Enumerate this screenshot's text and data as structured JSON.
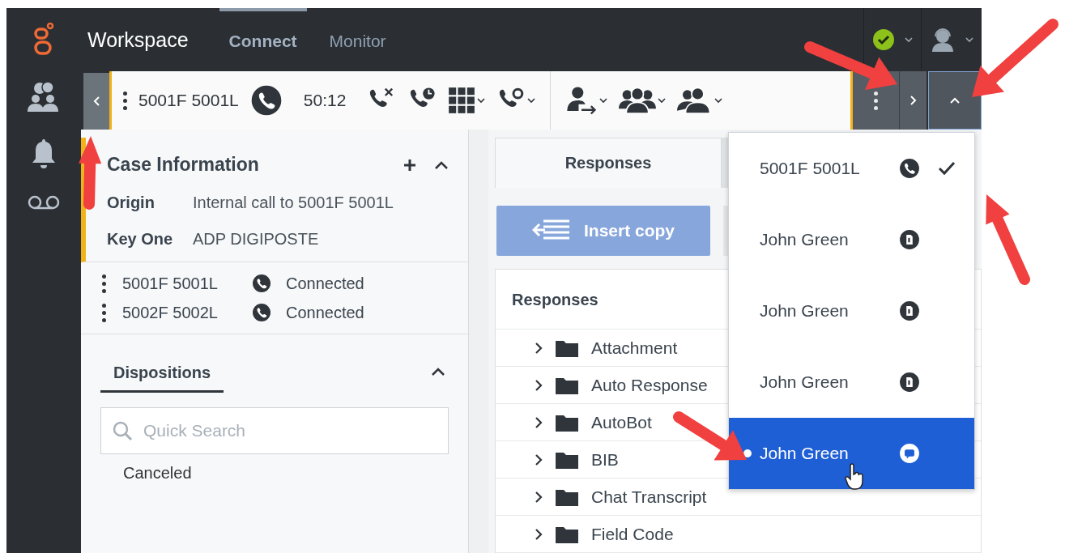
{
  "header": {
    "app_name": "Workspace",
    "nav": [
      {
        "label": "Connect",
        "selected": true
      },
      {
        "label": "Monitor",
        "selected": false
      }
    ]
  },
  "rail": {
    "items": [
      {
        "kind": "contacts"
      },
      {
        "kind": "bell"
      },
      {
        "kind": "voicemail"
      }
    ]
  },
  "toolbar": {
    "party": "5001F 5001L",
    "timer": "50:12",
    "actions": [
      {
        "kind": "end-call",
        "dropdown": false
      },
      {
        "kind": "hold-call",
        "dropdown": false
      },
      {
        "kind": "keypad",
        "dropdown": true
      },
      {
        "kind": "call-voicemail",
        "dropdown": true
      },
      {
        "kind": "transfer",
        "dropdown": true
      },
      {
        "kind": "conference",
        "dropdown": true
      },
      {
        "kind": "consult",
        "dropdown": true
      }
    ]
  },
  "case_info": {
    "title": "Case Information",
    "fields": [
      {
        "label": "Origin",
        "value": "Internal call to 5001F 5001L"
      },
      {
        "label": "Key One",
        "value": "ADP DIGIPOSTE"
      }
    ]
  },
  "parties": [
    {
      "name": "5001F 5001L",
      "status": "Connected"
    },
    {
      "name": "5002F 5002L",
      "status": "Connected"
    }
  ],
  "dispositions": {
    "tab": "Dispositions",
    "placeholder": "Quick Search",
    "items": [
      "Canceled"
    ]
  },
  "responses": {
    "tabs": [
      {
        "label": "Responses",
        "selected": true
      }
    ],
    "insert_button": {
      "label": "Insert copy",
      "disabled": true
    },
    "tree_title": "Responses",
    "folders": [
      "Attachment",
      "Auto Response",
      "AutoBot",
      "BIB",
      "Chat Transcript",
      "Field Code"
    ]
  },
  "interaction_menu": [
    {
      "name": "5001F 5001L",
      "kind": "voice",
      "checked": true,
      "selected": false
    },
    {
      "name": "John Green",
      "kind": "sms",
      "checked": false,
      "selected": false
    },
    {
      "name": "John Green",
      "kind": "sms",
      "checked": false,
      "selected": false
    },
    {
      "name": "John Green",
      "kind": "sms",
      "checked": false,
      "selected": false
    },
    {
      "name": "John Green",
      "kind": "chat",
      "checked": false,
      "selected": true
    }
  ],
  "annotations": [
    {
      "kind": "arrow"
    },
    {
      "kind": "arrow"
    },
    {
      "kind": "arrow"
    },
    {
      "kind": "arrow"
    },
    {
      "kind": "arrow"
    }
  ]
}
